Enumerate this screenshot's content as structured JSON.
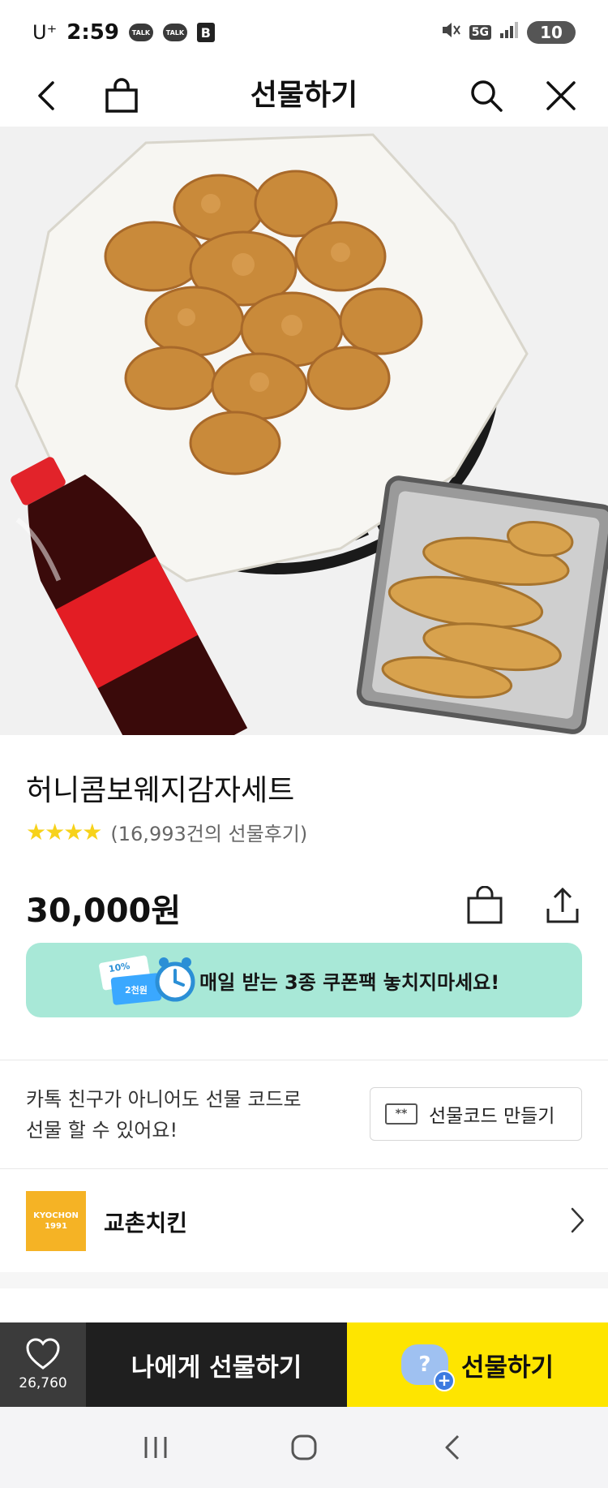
{
  "status_bar": {
    "carrier": "U⁺",
    "time": "2:59",
    "notif_talk": "TALK",
    "notif_b": "B",
    "network": "5G",
    "battery": "10"
  },
  "header": {
    "title": "선물하기"
  },
  "hero": {
    "icon": "product-photo"
  },
  "product": {
    "name": "허니콤보웨지감자세트",
    "stars": "★★★★",
    "review_count": "(16,993건의 선물후기)",
    "price": "30,000원"
  },
  "banner": {
    "text": "매일 받는 3종 쿠폰팩 놓치지마세요!",
    "tag_percent": "10%",
    "tag_amount": "2천원"
  },
  "gift_code": {
    "desc_line1": "카톡 친구가 아니어도 선물 코드로",
    "desc_line2": "선물 할 수 있어요!",
    "button_label": "선물코드 만들기",
    "button_icon_text": "**"
  },
  "brand": {
    "logo_line1": "KYOCHON",
    "logo_line2": "1991",
    "name": "교촌치킨"
  },
  "action_bar": {
    "like_count": "26,760",
    "self_gift_label": "나에게 선물하기",
    "gift_label": "선물하기",
    "gift_icon_text": "?"
  },
  "colors": {
    "banner_bg": "#a8e8d7",
    "gift_button": "#fee500",
    "self_gift_button": "#1f1f1f",
    "star": "#f7d21a",
    "brand_logo": "#f5b325"
  }
}
